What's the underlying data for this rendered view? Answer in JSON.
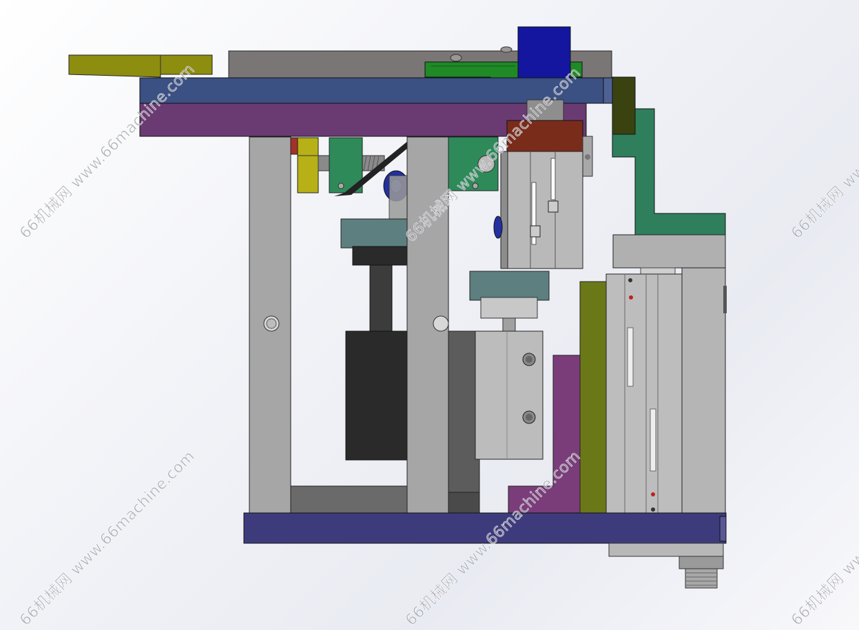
{
  "watermark": {
    "text": "66机械网 www.66machine.com",
    "color": "#9a9aa6"
  },
  "colors": {
    "background": "#eef0f5",
    "top_plate_blue": "#3b5083",
    "top_plate_purple": "#6a3a73",
    "base_plate": "#3e3b7d",
    "column_grey": "#a6a6a6",
    "olive_bracket": "#8d8d10",
    "green_clamp": "#1f8a26",
    "blue_block": "#1416a0",
    "teal_bracket": "#2f7f5d",
    "dark_olive": "#3a4310",
    "rust_cap": "#7a2c1a",
    "motor_black": "#2a2a2a",
    "cylinder_grey": "#b9b9b9",
    "purple_gusset": "#7a3d7a",
    "lime_plate": "#6b7818"
  },
  "parts": [
    "top-mounting-plate",
    "top-purple-plate",
    "left-support-column",
    "middle-support-column",
    "base-plate",
    "olive-handle-bracket",
    "green-clamp-block",
    "blue-sensor-block",
    "teal-l-bracket",
    "rust-cylinder-cap",
    "vertical-pneumatic-cylinder",
    "black-drive-motor",
    "grey-slide-cylinder",
    "purple-gusset",
    "lime-side-plate",
    "threaded-fitting"
  ]
}
